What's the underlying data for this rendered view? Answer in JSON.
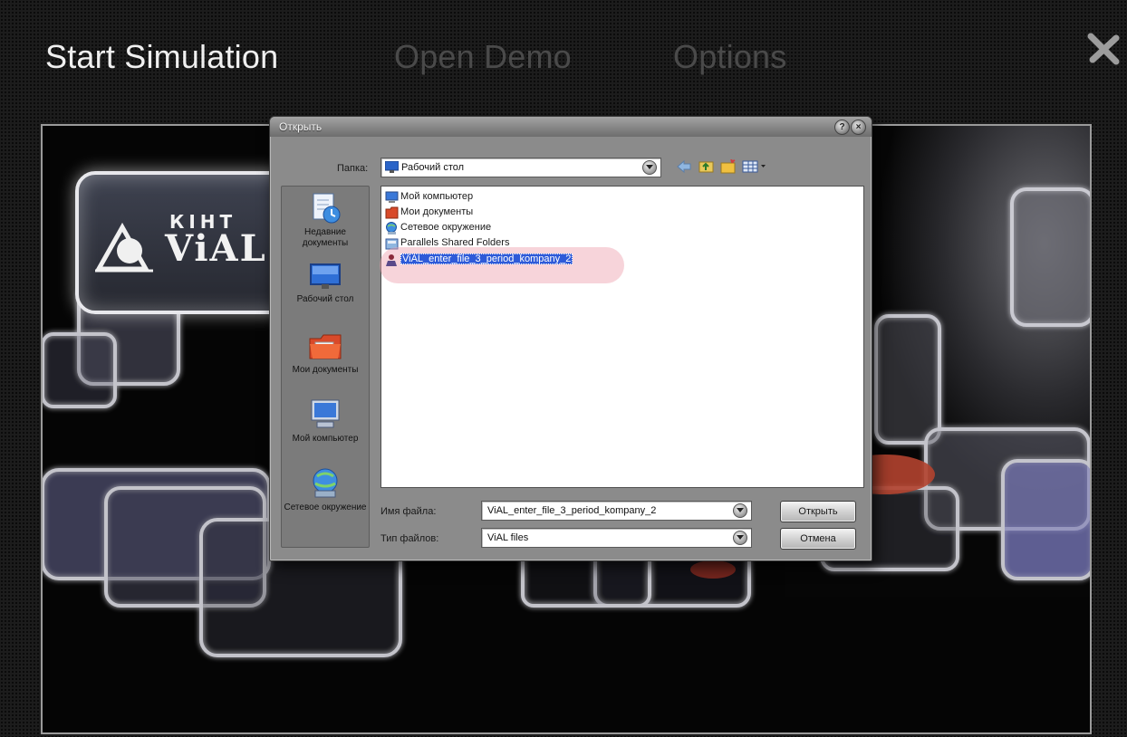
{
  "nav": {
    "start_label": "Start Simulation",
    "demo_label": "Open Demo",
    "options_label": "Options",
    "close_icon": "close-x-icon"
  },
  "splash": {
    "logo_top": "КІНТ",
    "logo_bottom": "ViAL"
  },
  "dialog": {
    "title": "Открыть",
    "lookin_label": "Папка:",
    "lookin_value": "Рабочий стол",
    "places": [
      {
        "label": "Недавние документы",
        "icon": "recent-docs-icon"
      },
      {
        "label": "Рабочий стол",
        "icon": "desktop-icon"
      },
      {
        "label": "Мои документы",
        "icon": "my-documents-icon"
      },
      {
        "label": "Мой компьютер",
        "icon": "my-computer-icon"
      },
      {
        "label": "Сетевое окружение",
        "icon": "network-icon"
      }
    ],
    "files": [
      {
        "name": "Мой компьютер",
        "icon": "computer-icon"
      },
      {
        "name": "Мои документы",
        "icon": "documents-folder-icon"
      },
      {
        "name": "Сетевое окружение",
        "icon": "network-icon"
      },
      {
        "name": "Parallels Shared Folders",
        "icon": "shared-folder-icon"
      },
      {
        "name": "ViAL_enter_file_3_period_kompany_2",
        "icon": "vial-file-icon",
        "selected": true
      }
    ],
    "filename_label": "Имя файла:",
    "filename_value": "ViAL_enter_file_3_period_kompany_2",
    "filetype_label": "Тип файлов:",
    "filetype_value": "ViAL files",
    "open_button": "Открыть",
    "cancel_button": "Отмена"
  },
  "colors": {
    "selection": "#2e5ad8",
    "highlight_mark": "#eea0ac",
    "nav_active": "#f0f0f0",
    "nav_inactive": "#4a4a4a"
  }
}
